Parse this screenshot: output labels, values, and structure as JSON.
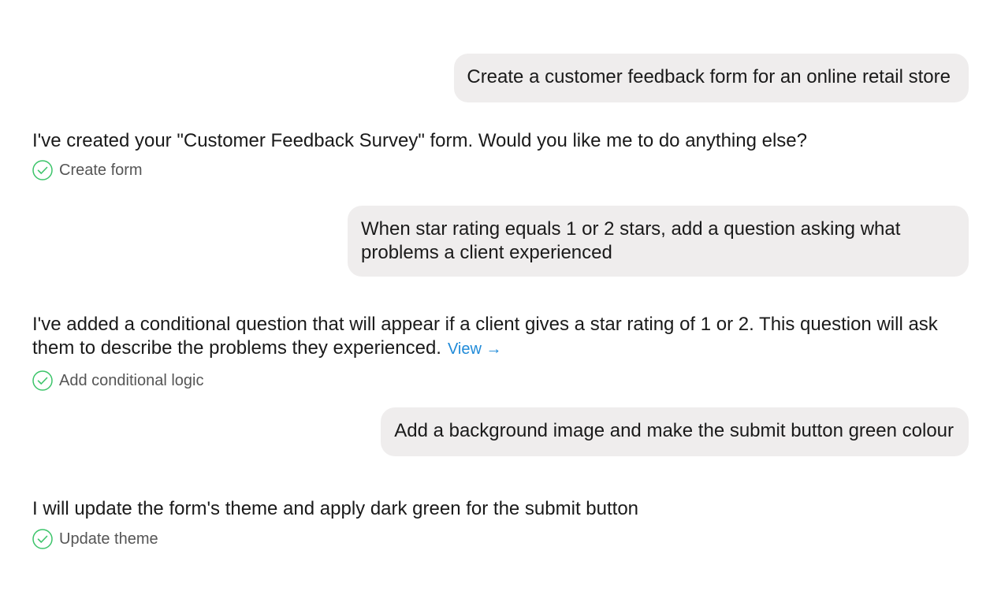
{
  "conversation": {
    "user_messages": [
      "Create a customer feedback form for an online retail store",
      "When star rating equals 1 or 2 stars, add a question asking what\nproblems a client experienced",
      "Add a background image and make the submit button green colour"
    ],
    "assistant_messages": [
      "I've created your \"Customer Feedback Survey\" form. Would you like me to do anything else?",
      "I've added a conditional question that will appear if a client gives a star rating of 1 or 2. This question will ask them to describe the problems they experienced.",
      "I will update the form's theme and apply dark green for the submit button"
    ],
    "view_link": "View",
    "view_arrow": "→",
    "actions": [
      {
        "label": "Create form",
        "icon": "check-circle-icon"
      },
      {
        "label": "Add conditional logic",
        "icon": "check-circle-icon"
      },
      {
        "label": "Update theme",
        "icon": "check-circle-icon"
      }
    ]
  },
  "colors": {
    "user_bubble_bg": "#efeded",
    "link": "#1f8ad8",
    "check": "#3cc46a",
    "text": "#1a1a1a",
    "muted": "#555555"
  }
}
